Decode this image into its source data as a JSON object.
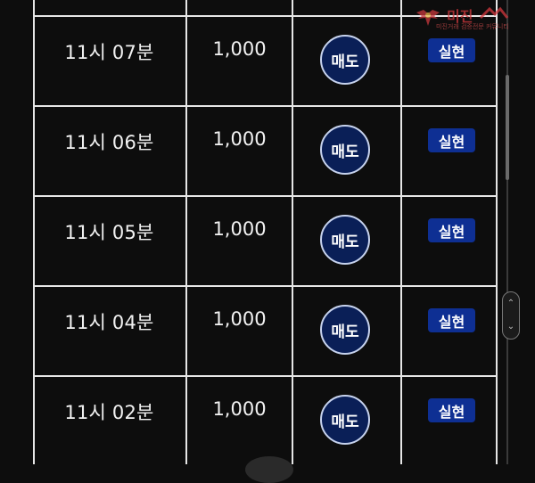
{
  "table": {
    "rows": [
      {
        "time": "11시 07분",
        "amount": "1,000",
        "action": "매도",
        "status": "실현"
      },
      {
        "time": "11시 06분",
        "amount": "1,000",
        "action": "매도",
        "status": "실현"
      },
      {
        "time": "11시 05분",
        "amount": "1,000",
        "action": "매도",
        "status": "실현"
      },
      {
        "time": "11시 04분",
        "amount": "1,000",
        "action": "매도",
        "status": "실현"
      },
      {
        "time": "11시 02분",
        "amount": "1,000",
        "action": "매도",
        "status": "실현"
      }
    ]
  },
  "watermark": {
    "main": "미진",
    "sub": "미진거래 검증전문 커뮤니티"
  },
  "colors": {
    "background": "#0d0d0d",
    "grid": "#e6e6e6",
    "sell_button": "#0a1f57",
    "status_badge": "#0e2f93"
  },
  "scroll": {
    "thumb_position": 0.25
  }
}
